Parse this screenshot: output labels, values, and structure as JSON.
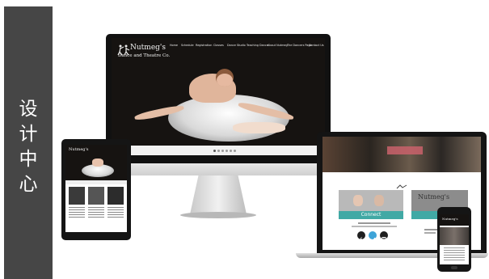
{
  "sidebar": {
    "title_chars": [
      "设",
      "计",
      "中",
      "心"
    ]
  },
  "site": {
    "logo_line1": "Nutmeg's",
    "logo_line2": "Dance and Theatre Co.",
    "nav": [
      "Home",
      "Schedule",
      "Registration",
      "Classes",
      "Dance Studio",
      "Teaching Dance",
      "About Nutmeg",
      "The Dancers Page",
      "Contact Us"
    ],
    "connect_label": "Connect",
    "social_icons": [
      "facebook-icon",
      "twitter-icon",
      "instagram-icon"
    ],
    "colors": {
      "teal": "#41a9a5",
      "facebook": "#1f1f1f",
      "twitter": "#3ea4d8",
      "instagram": "#1f1f1f"
    }
  }
}
